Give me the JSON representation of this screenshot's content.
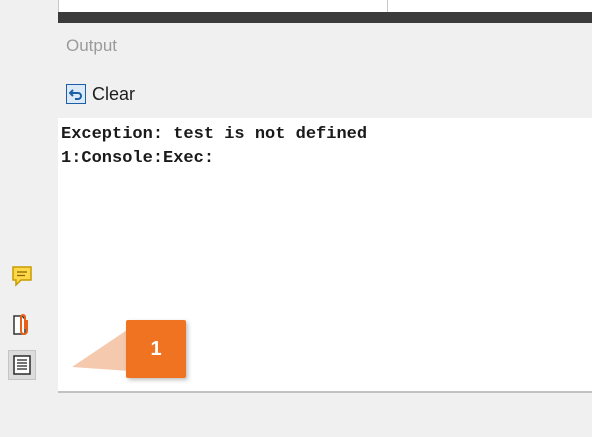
{
  "output_panel": {
    "title": "Output",
    "clear_label": "Clear"
  },
  "console": {
    "lines": [
      "Exception: test is not defined",
      "1:Console:Exec:"
    ]
  },
  "sidebar": {
    "icons": [
      "comment-icon",
      "attachment-icon",
      "output-log-icon"
    ]
  },
  "callout": {
    "number": "1",
    "color": "#f07321"
  },
  "colors": {
    "dark_bar": "#3b3b3b",
    "background": "#f0f0f0",
    "console_bg": "#ffffff",
    "icon_blue": "#1c5fa8",
    "comment_yellow": "#f2c500",
    "attachment_orange": "#e8611a"
  }
}
